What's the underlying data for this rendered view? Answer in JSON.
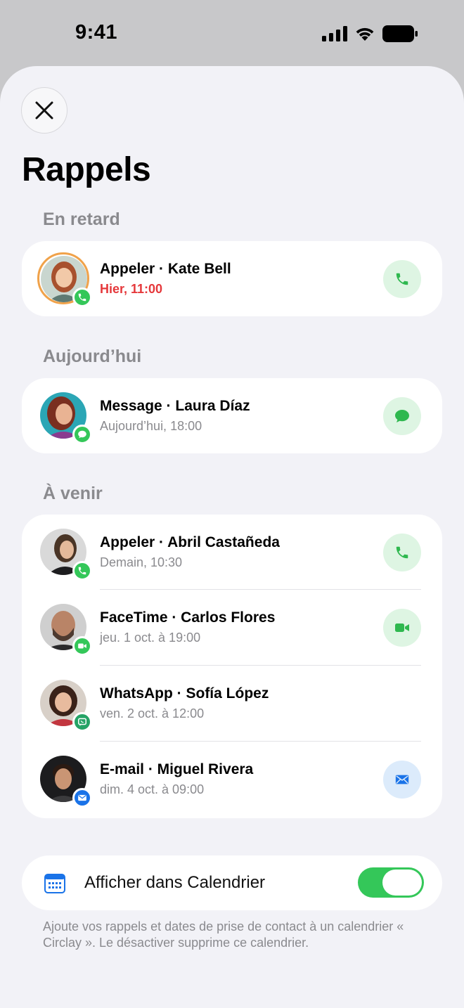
{
  "status": {
    "time": "9:41"
  },
  "title": "Rappels",
  "sections": {
    "overdue": "En retard",
    "today": "Aujourd’hui",
    "upcoming": "À venir"
  },
  "overdue": [
    {
      "title": "Appeler · Kate Bell",
      "subtitle": "Hier, 11:00",
      "badge": "phone-icon",
      "action": "phone-icon"
    }
  ],
  "today": [
    {
      "title": "Message · Laura Díaz",
      "subtitle": "Aujourd’hui, 18:00",
      "badge": "message-icon",
      "action": "message-icon"
    }
  ],
  "upcoming": [
    {
      "title": "Appeler · Abril Castañeda",
      "subtitle": "Demain, 10:30",
      "badge": "phone-icon",
      "action": "phone-icon"
    },
    {
      "title": "FaceTime · Carlos Flores",
      "subtitle": "jeu. 1 oct. à 19:00",
      "badge": "video-icon",
      "action": "video-icon"
    },
    {
      "title": "WhatsApp · Sofía López",
      "subtitle": "ven. 2 oct. à 12:00",
      "badge": "whatsapp-icon"
    },
    {
      "title": "E-mail · Miguel Rivera",
      "subtitle": "dim. 4 oct. à 09:00",
      "badge": "mail-icon",
      "action": "mail-icon"
    }
  ],
  "calendar": {
    "label": "Afficher dans Calendrier",
    "enabled": true,
    "footnote": "Ajoute vos rappels et dates de prise de contact à un calendrier « Circlay ». Le désactiver supprime ce calendrier."
  },
  "colors": {
    "accent_green": "#34c759",
    "late_red": "#e5383b",
    "mail_blue": "#1a73e8"
  }
}
